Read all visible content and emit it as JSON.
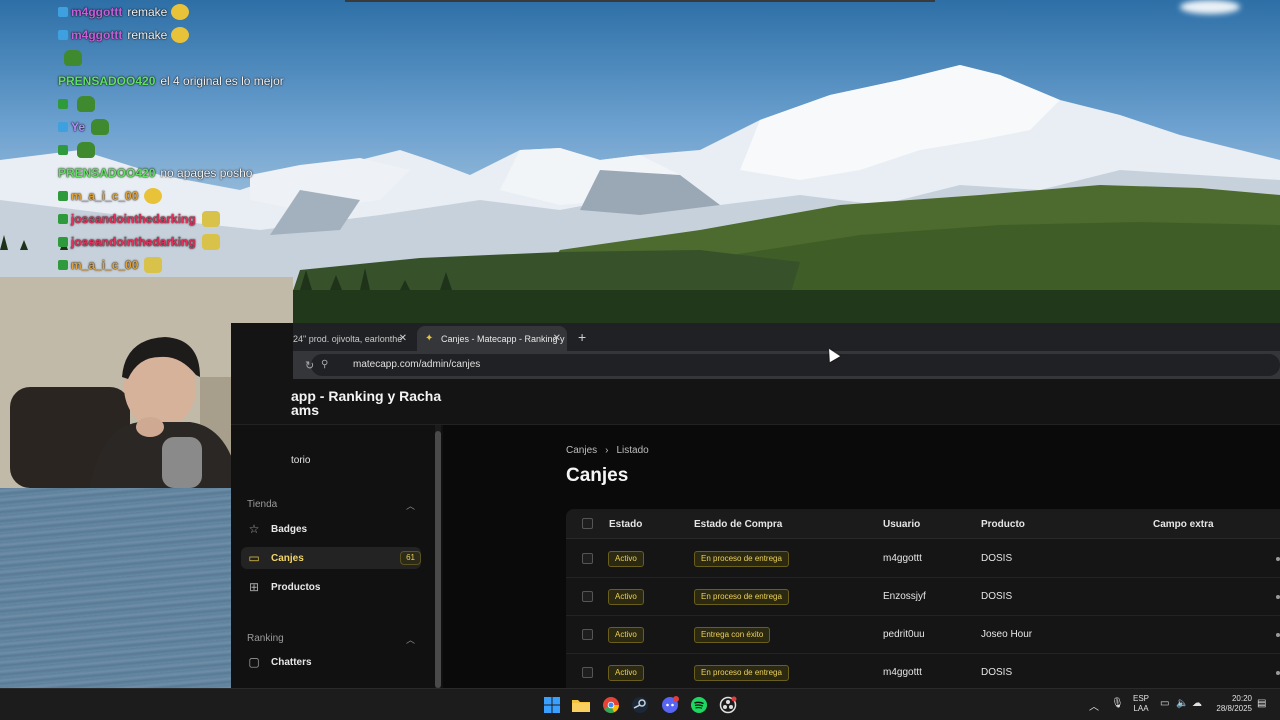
{
  "chat": {
    "lines": [
      {
        "user": "m4ggottt",
        "user_color": "#c75fd8",
        "message": "remake",
        "badge_color": "#3fa0e0",
        "emote": "laugh"
      },
      {
        "user": "m4ggottt",
        "user_color": "#c75fd8",
        "message": "remake",
        "badge_color": "#3fa0e0",
        "emote": "laugh"
      },
      {
        "user": "",
        "user_color": "#5fd860",
        "message": "",
        "badge_color": "",
        "emote": "pepe"
      },
      {
        "user": "PRENSADOO420",
        "user_color": "#62e062",
        "message": "el 4 original es lo mejor",
        "badge_color": "",
        "emote": ""
      },
      {
        "user": "",
        "user_color": "#c98bff",
        "message": "",
        "badge_color": "#2f9a3c",
        "emote": "pepe"
      },
      {
        "user": "Ye",
        "user_color": "#b28bff",
        "message": "",
        "badge_color": "#3fa0e0",
        "emote": "pepe"
      },
      {
        "user": "",
        "user_color": "#c98bff",
        "message": "",
        "badge_color": "#2f9a3c",
        "emote": "pepe"
      },
      {
        "user": "PRENSADOO420",
        "user_color": "#62e062",
        "message": "no apages posho",
        "badge_color": "",
        "emote": ""
      },
      {
        "user": "m_a_i_c_00",
        "user_color": "#e0a43a",
        "message": "",
        "badge_color": "#2f9a3c",
        "emote": "laugh"
      },
      {
        "user": "joseandointhedarking",
        "user_color": "#e0325a",
        "message": "",
        "badge_color": "#2f9a3c",
        "emote": "cool"
      },
      {
        "user": "joseandointhedarking",
        "user_color": "#e0325a",
        "message": "",
        "badge_color": "#2f9a3c",
        "emote": "cool"
      },
      {
        "user": "m_a_i_c_00",
        "user_color": "#e0a43a",
        "message": "",
        "badge_color": "#2f9a3c",
        "emote": "cool"
      }
    ]
  },
  "browser": {
    "tabs": [
      {
        "label": "24\" prod. ojivolta, earlonthe"
      },
      {
        "label": "Canjes - Matecapp - Ranking y"
      }
    ],
    "new_tab_glyph": "+",
    "close_glyph": "✕",
    "url": "matecapp.com/admin/canjes"
  },
  "app": {
    "brand_line1": "app - Ranking y Racha",
    "brand_line2": "ams",
    "sidebar": {
      "top_item": "torio",
      "groups": [
        {
          "label": "Tienda",
          "items": [
            {
              "label": "Badges",
              "icon": "star-icon"
            },
            {
              "label": "Canjes",
              "icon": "box-icon",
              "count": "61",
              "active": true
            },
            {
              "label": "Productos",
              "icon": "products-icon"
            }
          ]
        },
        {
          "label": "Ranking",
          "items": [
            {
              "label": "Chatters",
              "icon": "chat-icon"
            }
          ]
        }
      ]
    },
    "breadcrumb": [
      "Canjes",
      "Listado"
    ],
    "breadcrumb_sep": "›",
    "title": "Canjes",
    "table": {
      "columns": [
        "Estado",
        "Estado de Compra",
        "Usuario",
        "Producto",
        "Campo extra"
      ],
      "rows": [
        {
          "estado": "Activo",
          "compra": "En proceso de entrega",
          "usuario": "m4ggottt",
          "producto": "DOSIS"
        },
        {
          "estado": "Activo",
          "compra": "En proceso de entrega",
          "usuario": "Enzossjyf",
          "producto": "DOSIS"
        },
        {
          "estado": "Activo",
          "compra": "Entrega con éxito",
          "usuario": "pedrit0uu",
          "producto": "Joseo Hour"
        },
        {
          "estado": "Activo",
          "compra": "En proceso de entrega",
          "usuario": "m4ggottt",
          "producto": "DOSIS"
        }
      ]
    }
  },
  "taskbar": {
    "lang_line1": "ESP",
    "lang_line2": "LAA",
    "time": "20:20",
    "date": "28/8/2025",
    "discord_badge": "36"
  }
}
